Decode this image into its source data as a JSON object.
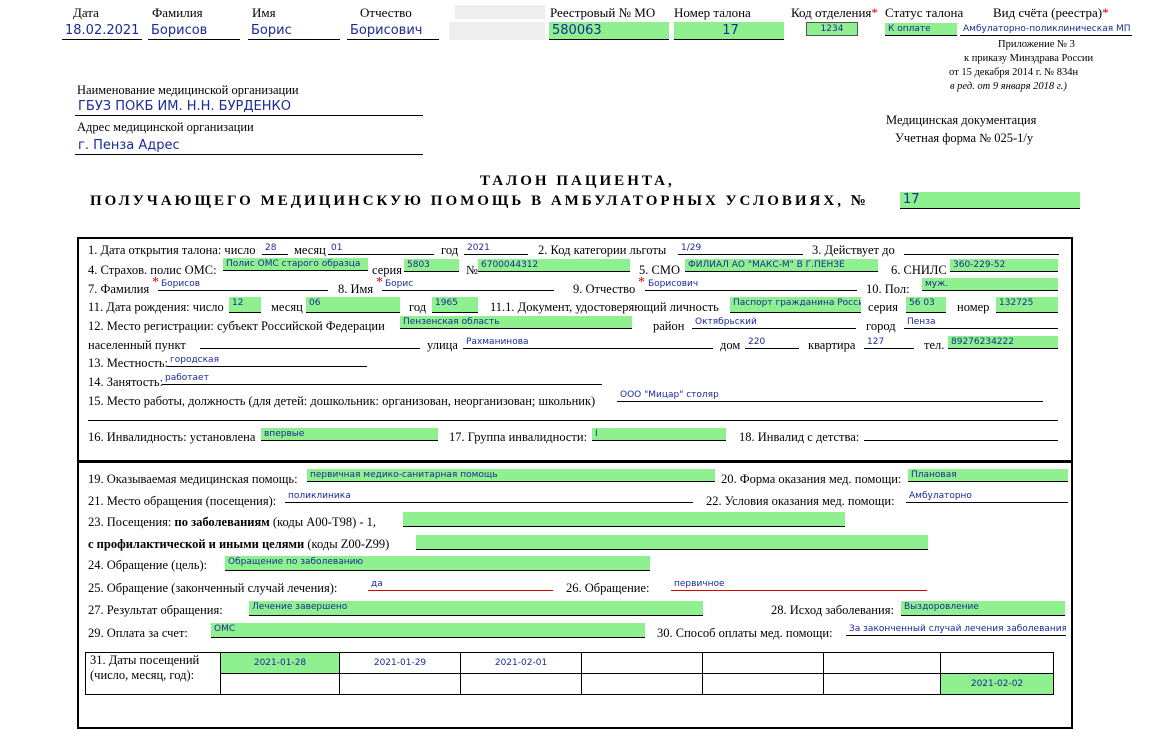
{
  "header": {
    "date_label": "Дата",
    "date_value": "18.02.2021",
    "surname_label": "Фамилия",
    "surname_value": "Борисов",
    "name_label": "Имя",
    "name_value": "Борис",
    "patronymic_label": "Отчество",
    "patronymic_value": "Борисович",
    "registry_label": "Реестровый № МО",
    "registry_value": "580063",
    "ticket_no_label": "Номер талона",
    "ticket_no_value": "17",
    "dept_label": "Код отделения",
    "dept_value": "1234",
    "status_label": "Статус талона",
    "status_value": "К оплате",
    "account_label": "Вид счёта (реестра)",
    "account_value": "Амбулаторно-поликлиническая МП",
    "star": "*"
  },
  "order": {
    "line1": "Приложение № 3",
    "line2": "к приказу Минздрава России",
    "line3": "от 15 декабря 2014 г. № 834н",
    "line4": "в ред. от 9 января 2018 г.)"
  },
  "org": {
    "name_label": "Наименование медицинской организации",
    "name_value": "ГБУЗ ПОКБ ИМ. Н.Н. БУРДЕНКО",
    "address_label": "Адрес медицинской организации",
    "address_value": "г. Пенза Адрес",
    "doc_line1": "Медицинская документация",
    "doc_line2": "Учетная форма № 025-1/у"
  },
  "title": {
    "line1": "ТАЛОН ПАЦИЕНТА,",
    "line2": "ПОЛУЧАЮЩЕГО МЕДИЦИНСКУЮ ПОМОЩЬ В АМБУЛАТОРНЫХ УСЛОВИЯХ, №",
    "number": "17"
  },
  "s1": {
    "l1": "1. Дата открытия талона: число",
    "v1": "28",
    "l1m": "месяц",
    "v1m": "01",
    "l1y": "год",
    "v1y": "2021",
    "l2": "2. Код категории льготы",
    "v2": "1/29",
    "l3": "3. Действует до",
    "v3": "",
    "l4": "4. Страхов. полис ОМС:",
    "v4": "Полис ОМС старого образца",
    "l4s": "серия",
    "v4s": "5803",
    "l4n": "№",
    "v4n": "6700044312",
    "l5": "5. СМО",
    "v5": "ФИЛИАЛ АО \"МАКС-М\" В Г.ПЕНЗЕ",
    "l6": "6. СНИЛС",
    "v6": "360-229-52",
    "l7": "7. Фамилия",
    "v7": "Борисов",
    "l8": "8. Имя",
    "v8": "Борис",
    "l9": "9. Отчество",
    "v9": "Борисович",
    "l10": "10. Пол:",
    "v10": "муж.",
    "l11": "11. Дата рождения: число",
    "v11": "12",
    "l11m": "месяц",
    "v11m": "06",
    "l11y": "год",
    "v11y": "1965",
    "l111": "11.1. Документ, удостоверяющий личность",
    "v111": "Паспорт гражданина Росси",
    "l111s": "серия",
    "v111s": "56 03",
    "l111n": "номер",
    "v111n": "132725",
    "l12": "12. Место регистрации: субъект Российской Федерации",
    "v12": "Пензенская область",
    "l12r": "район",
    "v12r": "Октябрьский",
    "l12c": "город",
    "v12c": "Пенза",
    "l12p": "населенный пункт",
    "v12p": "",
    "l12st": "улица",
    "v12st": "Рахманинова",
    "l12h": "дом",
    "v12h": "220",
    "l12a": "квартира",
    "v12a": "127",
    "l12t": "тел.",
    "v12t": "89276234222",
    "l13": "13. Местность:",
    "v13": "городская",
    "l14": "14. Занятость:",
    "v14": "работает",
    "l15": "15. Место работы, должность (для детей: дошкольник: организован, неорганизован; школьник)",
    "v15": "ООО \"Мицар\" столяр",
    "l16": "16. Инвалидность: установлена",
    "v16": "впервые",
    "l17": "17. Группа инвалидности:",
    "v17": "I",
    "l18": "18. Инвалид с детства:",
    "v18": ""
  },
  "s2": {
    "l19": "19. Оказываемая медицинская помощь:",
    "v19": "первичная медико-санитарная помощь",
    "l20": "20. Форма оказания мед. помощи:",
    "v20": "Плановая",
    "l21": "21. Место обращения (посещения):",
    "v21": "поликлиника",
    "l22": "22. Условия оказания мед. помощи:",
    "v22": "Амбулаторно",
    "l23a": "23. Посещения:",
    "l23b": "по заболеваниям",
    "l23c": "(коды А00-Т98) - 1,",
    "l23d": "с профилактической и иными целями",
    "l23e": "(коды Z00-Z99)",
    "l24": "24. Обращение (цель):",
    "v24": "Обращение по заболеванию",
    "l25": "25. Обращение (законченный случай лечения):",
    "v25": "да",
    "l26": "26. Обращение:",
    "v26": "первичное",
    "l27": "27. Результат обращения:",
    "v27": "Лечение завершено",
    "l28": "28. Исход заболевания:",
    "v28": "Выздоровление",
    "l29": "29. Оплата за счет:",
    "v29": "ОМС",
    "l30": "30. Способ оплаты мед. помощи:",
    "v30": "За законченный случай лечения заболевания",
    "l31a": "31. Даты посещений",
    "l31b": "(число, месяц, год):",
    "visits_row1": [
      "2021-01-28",
      "2021-01-29",
      "2021-02-01",
      "",
      "",
      "",
      ""
    ],
    "visits_row2": [
      "",
      "",
      "",
      "",
      "",
      "",
      "2021-02-02"
    ]
  }
}
